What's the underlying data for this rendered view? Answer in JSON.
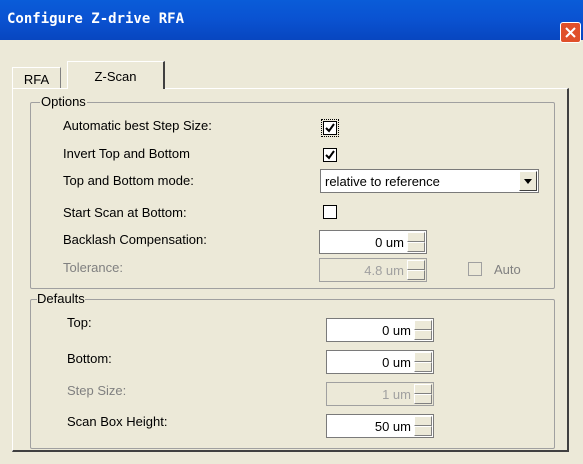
{
  "window": {
    "title": "Configure Z-drive RFA"
  },
  "tabs": [
    {
      "label": "RFA"
    },
    {
      "label": "Z-Scan"
    }
  ],
  "options": {
    "legend": "Options",
    "auto_best_step": {
      "label": "Automatic best Step Size:",
      "checked": true
    },
    "invert_top_bottom": {
      "label": "Invert Top and Bottom",
      "checked": true
    },
    "top_bottom_mode": {
      "label": "Top and Bottom mode:",
      "value": "relative to reference"
    },
    "start_scan_bottom": {
      "label": "Start Scan at Bottom:",
      "checked": false
    },
    "backlash": {
      "label": "Backlash Compensation:",
      "value": "0 um"
    },
    "tolerance": {
      "label": "Tolerance:",
      "value": "4.8 um",
      "auto_label": "Auto"
    }
  },
  "defaults": {
    "legend": "Defaults",
    "top": {
      "label": "Top:",
      "value": "0 um"
    },
    "bottom": {
      "label": "Bottom:",
      "value": "0 um"
    },
    "step_size": {
      "label": "Step Size:",
      "value": "1 um"
    },
    "scan_box_height": {
      "label": "Scan Box Height:",
      "value": "50 um"
    }
  }
}
